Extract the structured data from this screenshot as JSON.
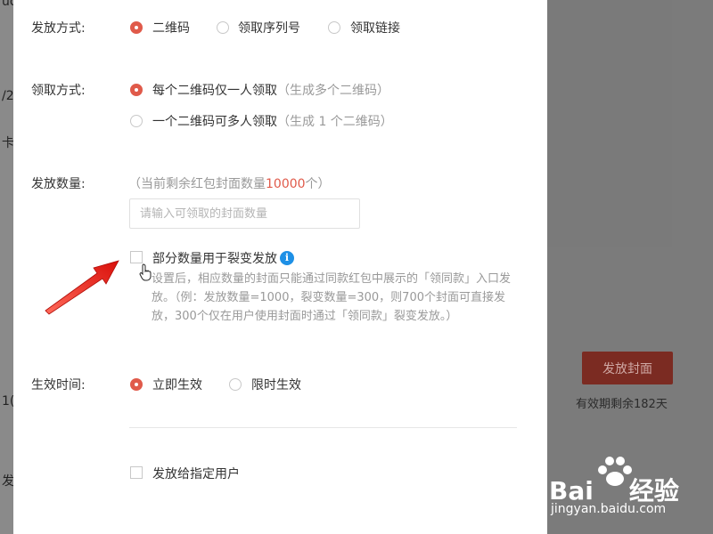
{
  "background": {
    "left_fragments": [
      "uot",
      "/2",
      "卡",
      "1(",
      "发"
    ],
    "publish_button": "发放封面",
    "validity_note": "有效期剩余182天"
  },
  "form": {
    "distribution_method": {
      "label": "发放方式:",
      "options": [
        "二维码",
        "领取序列号",
        "领取链接"
      ],
      "selected": "二维码"
    },
    "claim_method": {
      "label": "领取方式:",
      "options": [
        {
          "text": "每个二维码仅一人领取",
          "hint": "（生成多个二维码）"
        },
        {
          "text": "一个二维码可多人领取",
          "hint": "（生成 1 个二维码）"
        }
      ],
      "selected": 0
    },
    "quantity": {
      "label": "发放数量:",
      "remaining_prefix": "（当前剩余红包封面数量",
      "remaining_count": "10000",
      "remaining_suffix": "个）",
      "placeholder": "请输入可领取的封面数量",
      "value": ""
    },
    "fission": {
      "checkbox_label": "部分数量用于裂变发放",
      "checked": false,
      "info_icon": "i",
      "description": "设置后，相应数量的封面只能通过同款红包中展示的「领同款」入口发放。（例：发放数量=1000，裂变数量=300，则700个封面可直接发放，300个仅在用户使用封面时通过「领同款」裂变发放。）"
    },
    "effective_time": {
      "label": "生效时间:",
      "options": [
        "立即生效",
        "限时生效"
      ],
      "selected": "立即生效"
    },
    "target_users": {
      "checkbox_label": "发放给指定用户",
      "checked": false
    }
  },
  "watermark": {
    "logo": "Bai",
    "logo_suffix": "经验",
    "url": "jingyan.baidu.com"
  },
  "colors": {
    "accent": "#e05a4a",
    "info": "#1e90e6",
    "arrow": "#e0201a"
  }
}
